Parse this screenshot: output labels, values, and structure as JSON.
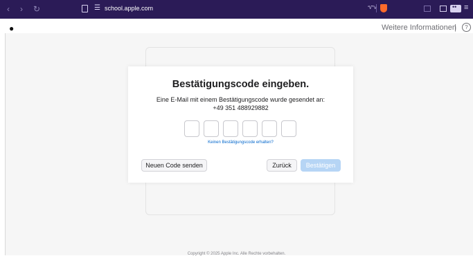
{
  "browser": {
    "url": "school.apple.com",
    "vpn_label": "ᏉV",
    "icons": [
      "back-icon",
      "forward-icon",
      "reload-icon",
      "bookmark-icon",
      "site-settings-icon",
      "brave-shield-icon",
      "sidebar-icon",
      "wallet-icon",
      "menu-icon"
    ]
  },
  "header": {
    "more_info": "Weitere Informationen",
    "divider": "|",
    "help": "?"
  },
  "dialog": {
    "title": "Bestätigungscode eingeben.",
    "description_line1": "Eine E-Mail mit einem Bestätigungscode wurde gesendet an:",
    "description_line2": "+49 351 488929882",
    "code_boxes": [
      "",
      "",
      "",
      "",
      "",
      ""
    ],
    "resend_link": "Keinen Bestätigungscode erhalten?",
    "new_code_button": "Neuen Code senden",
    "back_button": "Zurück",
    "confirm_button": "Bestätigen"
  },
  "footer": {
    "copyright": "Copyright © 2025 Apple Inc. Alle Rechte vorbehalten."
  },
  "colors": {
    "chrome_bg": "#2b1b57",
    "link": "#0066cc",
    "confirm_disabled": "#b6d5f5"
  }
}
